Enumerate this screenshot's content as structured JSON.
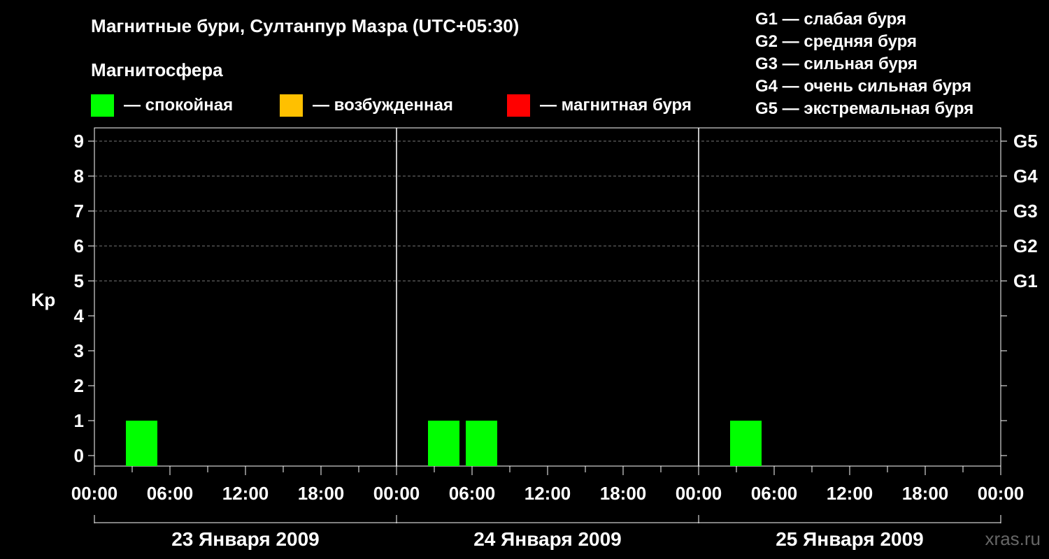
{
  "title": "Магнитные бури, Султанпур Мазра (UTC+05:30)",
  "magnetosphere": {
    "title": "Магнитосфера",
    "items": [
      {
        "color": "#00ff00",
        "label": "— спокойная"
      },
      {
        "color": "#ffc000",
        "label": "— возбужденная"
      },
      {
        "color": "#ff0000",
        "label": "— магнитная буря"
      }
    ]
  },
  "storm_levels": [
    "G1 — слабая буря",
    "G2 — средняя буря",
    "G3 — сильная буря",
    "G4 — очень сильная буря",
    "G5 — экстремальная буря"
  ],
  "site": "xras.ru",
  "chart_data": {
    "type": "bar",
    "ylabel": "Kp",
    "ylim": [
      0,
      9
    ],
    "y_ticks": [
      "0",
      "1",
      "2",
      "3",
      "4",
      "5",
      "6",
      "7",
      "8",
      "9"
    ],
    "right_ticks": [
      {
        "kp": 5,
        "label": "G1"
      },
      {
        "kp": 6,
        "label": "G2"
      },
      {
        "kp": 7,
        "label": "G3"
      },
      {
        "kp": 8,
        "label": "G4"
      },
      {
        "kp": 9,
        "label": "G5"
      }
    ],
    "x_tick_labels": [
      "00:00",
      "06:00",
      "12:00",
      "18:00",
      "00:00",
      "06:00",
      "12:00",
      "18:00",
      "00:00",
      "06:00",
      "12:00",
      "18:00",
      "00:00"
    ],
    "days": [
      "23 Января 2009",
      "24 Января 2009",
      "25 Января 2009"
    ],
    "grid": true,
    "bars": [
      {
        "day": 0,
        "start_hour": 2.5,
        "end_hour": 5,
        "kp": 1,
        "color": "#00ff00"
      },
      {
        "day": 1,
        "start_hour": 2.5,
        "end_hour": 5,
        "kp": 1,
        "color": "#00ff00"
      },
      {
        "day": 1,
        "start_hour": 5.5,
        "end_hour": 8,
        "kp": 1,
        "color": "#00ff00"
      },
      {
        "day": 2,
        "start_hour": 2.5,
        "end_hour": 5,
        "kp": 1,
        "color": "#00ff00"
      }
    ]
  }
}
